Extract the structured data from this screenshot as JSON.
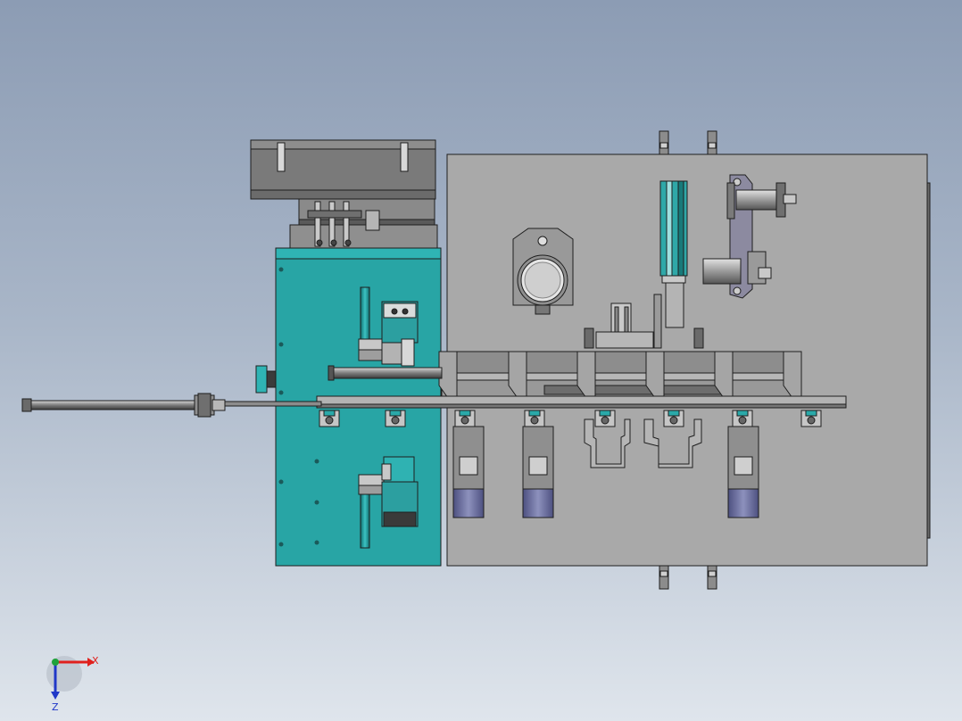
{
  "viewport": {
    "background_top": "#8c9cb4",
    "background_bottom": "#dfe5ec"
  },
  "colors": {
    "teal": "#28a5a5",
    "teal_dark": "#1a7f80",
    "plate_gray": "#a9a9a9",
    "steel": "#8a8a8a",
    "steel_dark": "#5b5b5b",
    "cylinder_purple": "#6b6f99",
    "outline": "#1e1e1e"
  },
  "triad": {
    "x_label": "X",
    "z_label": "Z",
    "x_color": "#e0201c",
    "y_color": "#1fa23a",
    "z_color": "#2038c8"
  }
}
